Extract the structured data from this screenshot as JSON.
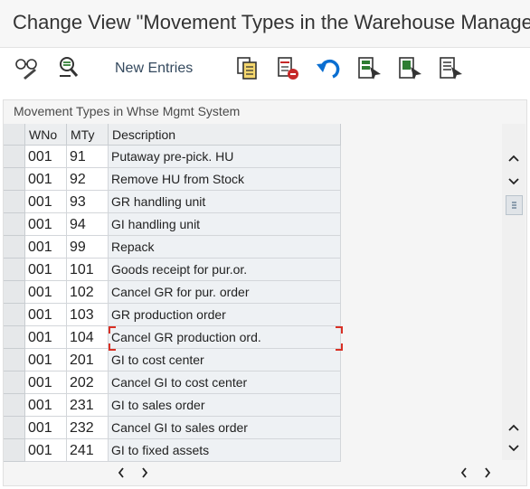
{
  "window": {
    "title": "Change View \"Movement Types in the Warehouse Management System\": Overview"
  },
  "toolbar": {
    "new_entries_label": "New Entries",
    "icons": [
      "display-change-icon",
      "find-icon",
      "copy-as-icon",
      "delete-icon",
      "undo-change-icon",
      "select-all-icon",
      "select-block-icon",
      "deselect-all-icon"
    ]
  },
  "table": {
    "title": "Movement Types in Whse Mgmt System",
    "columns": [
      "WNo",
      "MTy",
      "Description"
    ],
    "rows": [
      {
        "wno": "001",
        "mty": "91",
        "desc": "Putaway pre-pick. HU"
      },
      {
        "wno": "001",
        "mty": "92",
        "desc": "Remove HU from Stock"
      },
      {
        "wno": "001",
        "mty": "93",
        "desc": "GR handling unit"
      },
      {
        "wno": "001",
        "mty": "94",
        "desc": "GI handling unit"
      },
      {
        "wno": "001",
        "mty": "99",
        "desc": "Repack"
      },
      {
        "wno": "001",
        "mty": "101",
        "desc": "Goods receipt for pur.or."
      },
      {
        "wno": "001",
        "mty": "102",
        "desc": "Cancel GR for pur. order"
      },
      {
        "wno": "001",
        "mty": "103",
        "desc": "GR production order"
      },
      {
        "wno": "001",
        "mty": "104",
        "desc": "Cancel GR production ord."
      },
      {
        "wno": "001",
        "mty": "201",
        "desc": "GI to cost center"
      },
      {
        "wno": "001",
        "mty": "202",
        "desc": "Cancel GI to cost center"
      },
      {
        "wno": "001",
        "mty": "231",
        "desc": "GI to sales order"
      },
      {
        "wno": "001",
        "mty": "232",
        "desc": "Cancel GI to sales order"
      },
      {
        "wno": "001",
        "mty": "241",
        "desc": "GI to fixed assets"
      }
    ],
    "focused_row_index": 8
  },
  "colors": {
    "accent": "#0a6ed1",
    "focus": "#d93025",
    "icon_green": "#2e7d32",
    "icon_red": "#c62828"
  }
}
